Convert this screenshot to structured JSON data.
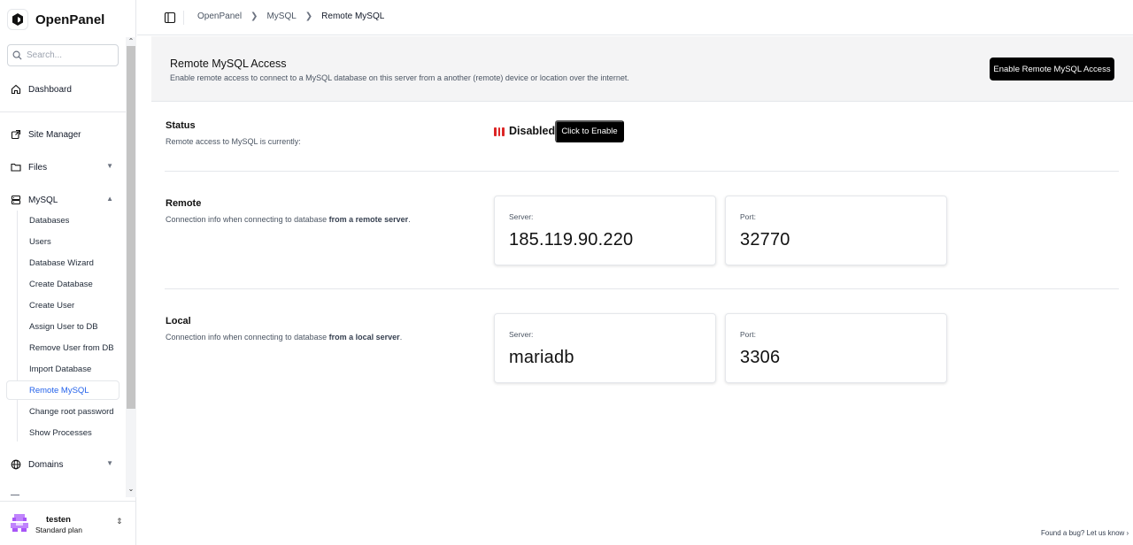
{
  "brand": {
    "name": "OpenPanel"
  },
  "search": {
    "placeholder": "Search..."
  },
  "sidebar": {
    "dashboard": "Dashboard",
    "site_manager": "Site Manager",
    "files": "Files",
    "mysql": "MySQL",
    "domains": "Domains",
    "mysql_items": [
      "Databases",
      "Users",
      "Database Wizard",
      "Create Database",
      "Create User",
      "Assign User to DB",
      "Remove User from DB",
      "Import Database",
      "Remote MySQL",
      "Change root password",
      "Show Processes"
    ],
    "active_item": "Remote MySQL"
  },
  "user": {
    "name": "testen",
    "plan": "Standard plan"
  },
  "breadcrumb": {
    "items": [
      "OpenPanel",
      "MySQL",
      "Remote MySQL"
    ]
  },
  "header": {
    "title": "Remote MySQL Access",
    "description": "Enable remote access to connect to a MySQL database on this server from a another (remote) device or location over the internet.",
    "button": "Enable Remote MySQL Access"
  },
  "status": {
    "title": "Status",
    "description": "Remote access to MySQL is currently:",
    "value": "Disabled",
    "button": "Click to Enable",
    "color": "#dc2626"
  },
  "remote": {
    "title": "Remote",
    "desc_prefix": "Connection info when connecting to database ",
    "desc_bold": "from a remote server",
    "desc_suffix": ".",
    "server_label": "Server:",
    "server_value": "185.119.90.220",
    "port_label": "Port:",
    "port_value": "32770"
  },
  "local": {
    "title": "Local",
    "desc_prefix": "Connection info when connecting to database ",
    "desc_bold": "from a local server",
    "desc_suffix": ".",
    "server_label": "Server:",
    "server_value": "mariadb",
    "port_label": "Port:",
    "port_value": "3306"
  },
  "footer": {
    "bug_link": "Found a bug? Let us know"
  }
}
